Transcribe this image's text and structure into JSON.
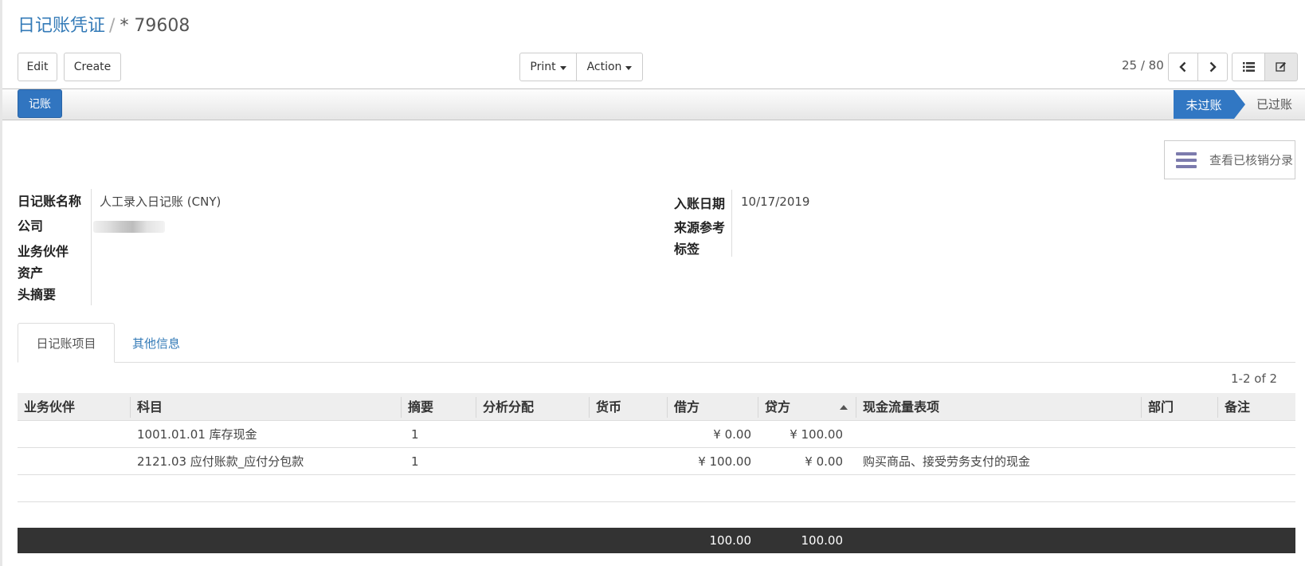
{
  "breadcrumb": {
    "parent": "日记账凭证",
    "separator": "/",
    "current": "* 79608"
  },
  "toolbar": {
    "edit_label": "Edit",
    "create_label": "Create",
    "print_label": "Print",
    "action_label": "Action"
  },
  "pager": {
    "value": "25 / 80"
  },
  "icons": {
    "prev": "chevron-left-icon",
    "next": "chevron-right-icon",
    "list_view": "list-view-icon",
    "form_view": "form-view-edit-icon",
    "smart_button": "bars-icon"
  },
  "statusbar": {
    "post_label": "记账",
    "stages": [
      {
        "label": "未过账",
        "active": true
      },
      {
        "label": "已过账",
        "active": false
      }
    ]
  },
  "smart_button": {
    "label": "查看已核销分录"
  },
  "form": {
    "left_labels": [
      "日记账名称",
      "公司",
      "业务伙伴",
      "资产",
      "头摘要"
    ],
    "journal_value": "人工录入日记账 (CNY)",
    "right_labels": [
      "入账日期",
      "来源参考",
      "标签"
    ],
    "date_value": "10/17/2019"
  },
  "tabs": [
    {
      "label": "日记账项目",
      "active": true
    },
    {
      "label": "其他信息",
      "active": false
    }
  ],
  "record_counter": "1-2 of 2",
  "table": {
    "columns": [
      "业务伙伴",
      "科目",
      "摘要",
      "分析分配",
      "货币",
      "借方",
      "贷方",
      "现金流量表项",
      "部门",
      "备注"
    ],
    "rows": [
      {
        "partner": "",
        "account": "1001.01.01 库存现金",
        "label": "1",
        "analytic": "",
        "currency": "",
        "debit": "¥ 0.00",
        "credit": "¥ 100.00",
        "cashflow": "",
        "dept": "",
        "note": ""
      },
      {
        "partner": "",
        "account": "2121.03 应付账款_应付分包款",
        "label": "1",
        "analytic": "",
        "currency": "",
        "debit": "¥ 100.00",
        "credit": "¥ 0.00",
        "cashflow": "购买商品、接受劳务支付的现金",
        "dept": "",
        "note": ""
      }
    ],
    "totals": {
      "debit": "100.00",
      "credit": "100.00"
    }
  },
  "colors": {
    "primary": "#3175c0",
    "link": "#337ab7",
    "footer": "#333333",
    "header_bg": "#eeeeee",
    "smart_icon": "#7c7bad"
  }
}
